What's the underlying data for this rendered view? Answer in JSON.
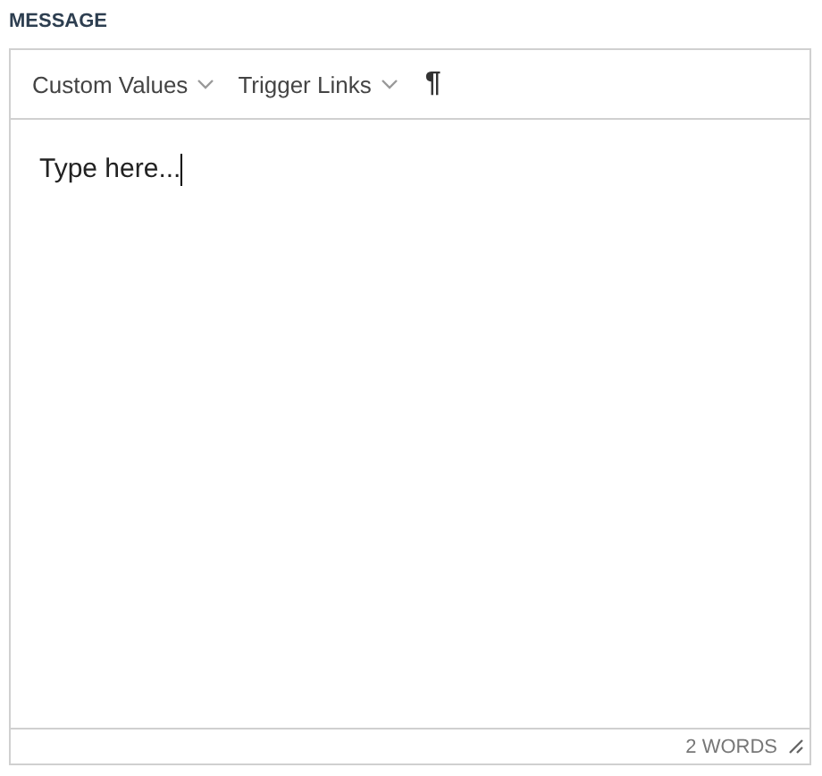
{
  "label": "MESSAGE",
  "toolbar": {
    "dropdowns": [
      {
        "label": "Custom Values"
      },
      {
        "label": "Trigger Links"
      }
    ],
    "paragraph_button": "¶"
  },
  "editor": {
    "value": "Type here..."
  },
  "status_bar": {
    "word_count": "2 WORDS"
  }
}
